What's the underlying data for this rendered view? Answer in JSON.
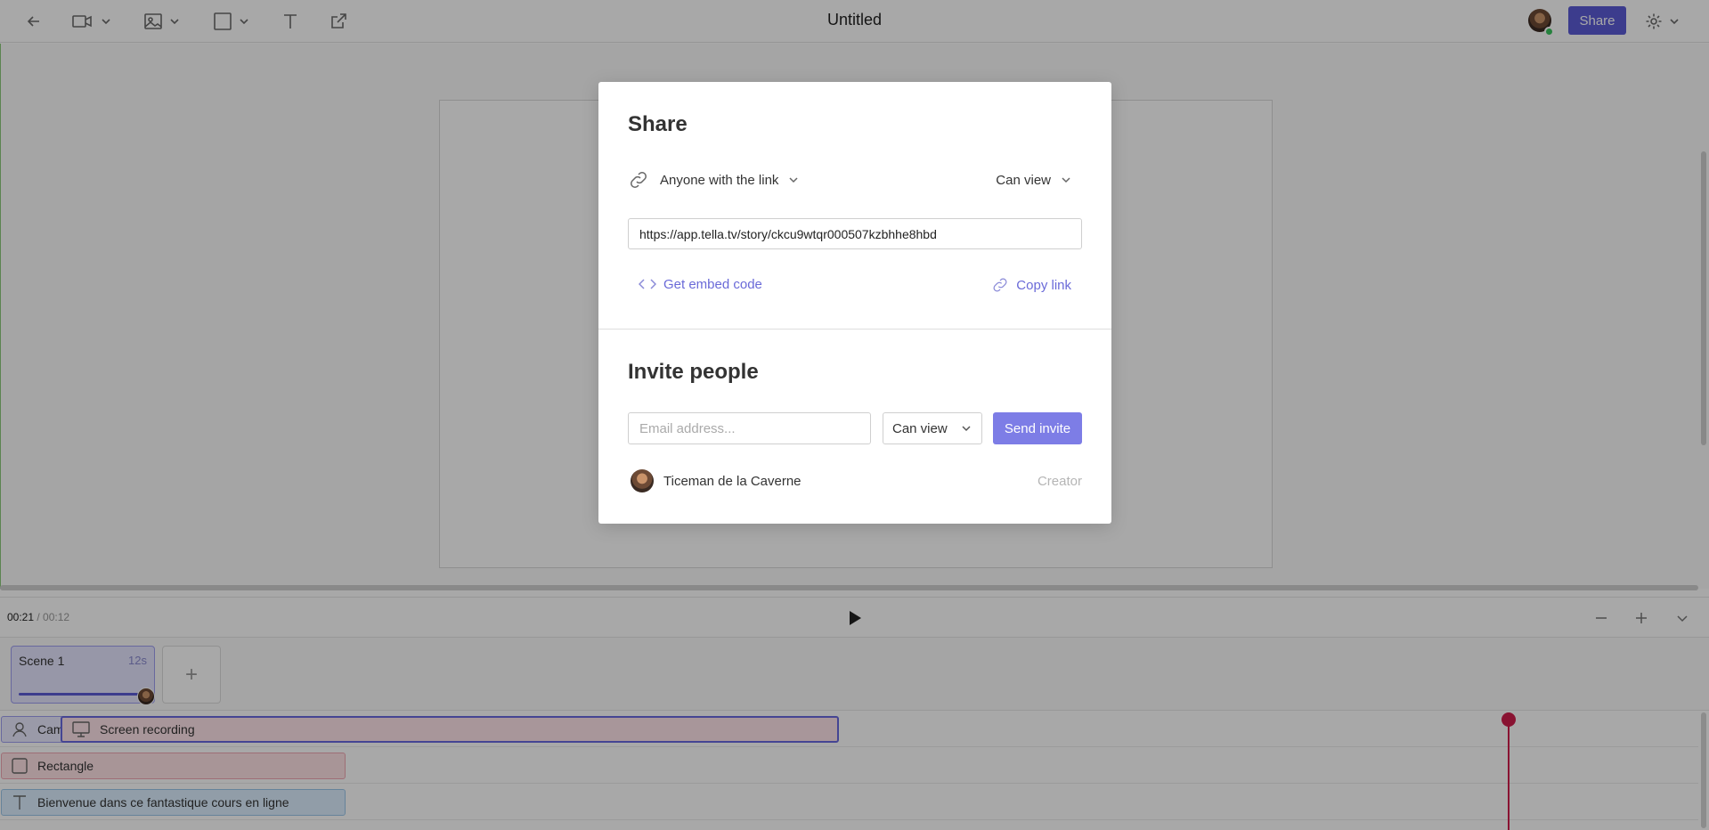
{
  "document": {
    "title": "Untitled"
  },
  "toolbar": {
    "share_label": "Share"
  },
  "playback": {
    "current_time": "00:21",
    "separator": " / ",
    "total_time": "00:12"
  },
  "scenes": [
    {
      "name": "Scene 1",
      "duration": "12s",
      "progress": 1.0
    }
  ],
  "add_scene_label": "+",
  "tracks": {
    "camera_label": "Camera",
    "screen_label": "Screen recording",
    "rectangle_label": "Rectangle",
    "text_label": "Bienvenue dans ce fantastique cours en ligne"
  },
  "share_modal": {
    "title": "Share",
    "link_scope": "Anyone with the link",
    "link_permission": "Can view",
    "url": "https://app.tella.tv/story/ckcu9wtqr000507kzbhhe8hbd",
    "embed_label": "Get embed code",
    "copy_label": "Copy link",
    "invite_title": "Invite people",
    "email_placeholder": "Email address...",
    "invite_role": "Can view",
    "send_label": "Send invite",
    "members": [
      {
        "name": "Ticeman de la Caverne",
        "role": "Creator"
      }
    ]
  },
  "colors": {
    "accent": "#5b5bd6",
    "playhead": "#d11d4c",
    "online": "#3bc45f"
  },
  "icons": [
    "back-arrow-icon",
    "video-camera-icon",
    "image-icon",
    "square-icon",
    "text-icon",
    "external-link-icon",
    "gear-icon",
    "play-icon",
    "zoom-out-icon",
    "zoom-in-icon",
    "chevron-down-icon",
    "link-icon",
    "code-icon",
    "person-icon",
    "monitor-icon"
  ]
}
